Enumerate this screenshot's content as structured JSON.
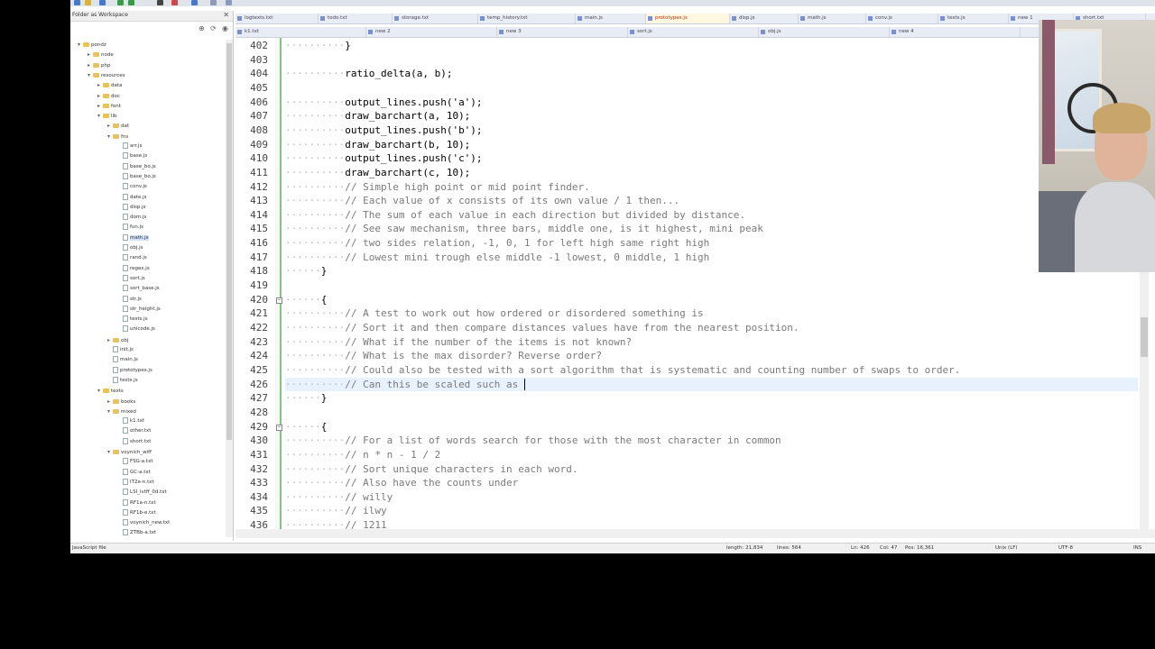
{
  "window": {
    "sidebar_title": "Folder as Workspace"
  },
  "sidebar": {
    "tree": [
      {
        "label": "pondz",
        "depth": 0,
        "type": "folder",
        "open": true
      },
      {
        "label": "node",
        "depth": 1,
        "type": "folder",
        "open": false
      },
      {
        "label": "php",
        "depth": 1,
        "type": "folder",
        "open": false
      },
      {
        "label": "resources",
        "depth": 1,
        "type": "folder",
        "open": true
      },
      {
        "label": "data",
        "depth": 2,
        "type": "folder",
        "open": false
      },
      {
        "label": "doc",
        "depth": 2,
        "type": "folder",
        "open": false
      },
      {
        "label": "font",
        "depth": 2,
        "type": "folder",
        "open": false
      },
      {
        "label": "lib",
        "depth": 2,
        "type": "folder",
        "open": true
      },
      {
        "label": "dat",
        "depth": 3,
        "type": "folder",
        "open": false
      },
      {
        "label": "fns",
        "depth": 3,
        "type": "folder",
        "open": true
      },
      {
        "label": "arr.js",
        "depth": 4,
        "type": "file"
      },
      {
        "label": "base.js",
        "depth": 4,
        "type": "file"
      },
      {
        "label": "base_bo.js",
        "depth": 4,
        "type": "file"
      },
      {
        "label": "base_bo.js",
        "depth": 4,
        "type": "file"
      },
      {
        "label": "conv.js",
        "depth": 4,
        "type": "file"
      },
      {
        "label": "date.js",
        "depth": 4,
        "type": "file"
      },
      {
        "label": "disp.js",
        "depth": 4,
        "type": "file"
      },
      {
        "label": "dom.js",
        "depth": 4,
        "type": "file"
      },
      {
        "label": "fun.js",
        "depth": 4,
        "type": "file"
      },
      {
        "label": "math.js",
        "depth": 4,
        "type": "file",
        "selected": true
      },
      {
        "label": "obj.js",
        "depth": 4,
        "type": "file"
      },
      {
        "label": "rand.js",
        "depth": 4,
        "type": "file"
      },
      {
        "label": "regex.js",
        "depth": 4,
        "type": "file"
      },
      {
        "label": "sort.js",
        "depth": 4,
        "type": "file"
      },
      {
        "label": "sort_base.js",
        "depth": 4,
        "type": "file"
      },
      {
        "label": "str.js",
        "depth": 4,
        "type": "file"
      },
      {
        "label": "str_height.js",
        "depth": 4,
        "type": "file"
      },
      {
        "label": "tests.js",
        "depth": 4,
        "type": "file"
      },
      {
        "label": "unicode.js",
        "depth": 4,
        "type": "file"
      },
      {
        "label": "obj",
        "depth": 3,
        "type": "folder",
        "open": false
      },
      {
        "label": "init.js",
        "depth": 3,
        "type": "file"
      },
      {
        "label": "main.js",
        "depth": 3,
        "type": "file"
      },
      {
        "label": "prototypes.js",
        "depth": 3,
        "type": "file"
      },
      {
        "label": "tests.js",
        "depth": 3,
        "type": "file"
      },
      {
        "label": "texts",
        "depth": 2,
        "type": "folder",
        "open": true
      },
      {
        "label": "books",
        "depth": 3,
        "type": "folder",
        "open": false
      },
      {
        "label": "mixed",
        "depth": 3,
        "type": "folder",
        "open": true
      },
      {
        "label": "k1.txt",
        "depth": 4,
        "type": "file"
      },
      {
        "label": "other.txt",
        "depth": 4,
        "type": "file"
      },
      {
        "label": "short.txt",
        "depth": 4,
        "type": "file"
      },
      {
        "label": "voynich_wiff",
        "depth": 3,
        "type": "folder",
        "open": true
      },
      {
        "label": "FSG-a.txt",
        "depth": 4,
        "type": "file"
      },
      {
        "label": "GC-a.txt",
        "depth": 4,
        "type": "file"
      },
      {
        "label": "IT2e-n.txt",
        "depth": 4,
        "type": "file"
      },
      {
        "label": "LSI_ivtff_0d.txt",
        "depth": 4,
        "type": "file"
      },
      {
        "label": "RF1a-n.txt",
        "depth": 4,
        "type": "file"
      },
      {
        "label": "RF1b-e.txt",
        "depth": 4,
        "type": "file"
      },
      {
        "label": "voynich_new.txt",
        "depth": 4,
        "type": "file"
      },
      {
        "label": "ZTBb-a.txt",
        "depth": 4,
        "type": "file"
      }
    ]
  },
  "tabs_row1": [
    "logtexts.txt",
    "todo.txt",
    "storage.txt",
    "temp_history.txt",
    "main.js",
    "prototypes.js",
    "disp.js",
    "math.js",
    "conv.js",
    "tests.js",
    "new 1",
    "short.txt"
  ],
  "tabs_row1_active": 5,
  "tabs_row2": [
    "k1.txt",
    "new 2",
    "new 3",
    "sort.js",
    "obj.js",
    "new 4"
  ],
  "editor": {
    "lines": [
      {
        "n": "402",
        "indent": 10,
        "text": "}",
        "type": "code"
      },
      {
        "n": "403",
        "indent": 0,
        "text": "",
        "type": "code"
      },
      {
        "n": "404",
        "indent": 10,
        "text": "ratio_delta(a, b);",
        "type": "code"
      },
      {
        "n": "405",
        "indent": 0,
        "text": "",
        "type": "code"
      },
      {
        "n": "406",
        "indent": 10,
        "text": "output_lines.push('a');",
        "type": "code"
      },
      {
        "n": "407",
        "indent": 10,
        "text": "draw_barchart(a, 10);",
        "type": "code"
      },
      {
        "n": "408",
        "indent": 10,
        "text": "output_lines.push('b');",
        "type": "code"
      },
      {
        "n": "409",
        "indent": 10,
        "text": "draw_barchart(b, 10);",
        "type": "code"
      },
      {
        "n": "410",
        "indent": 10,
        "text": "output_lines.push('c');",
        "type": "code"
      },
      {
        "n": "411",
        "indent": 10,
        "text": "draw_barchart(c, 10);",
        "type": "code"
      },
      {
        "n": "412",
        "indent": 10,
        "text": "// Simple high point or mid point finder.",
        "type": "comment"
      },
      {
        "n": "413",
        "indent": 10,
        "text": "// Each value of x consists of its own value / 1 then...",
        "type": "comment"
      },
      {
        "n": "414",
        "indent": 10,
        "text": "// The sum of each value in each direction but divided by distance.",
        "type": "comment"
      },
      {
        "n": "415",
        "indent": 10,
        "text": "// See saw mechanism, three bars, middle one, is it highest, mini peak",
        "type": "comment"
      },
      {
        "n": "416",
        "indent": 10,
        "text": "// two sides relation, -1, 0, 1 for left high same right high",
        "type": "comment"
      },
      {
        "n": "417",
        "indent": 10,
        "text": "// Lowest mini trough else middle -1 lowest, 0 middle, 1 high",
        "type": "comment"
      },
      {
        "n": "418",
        "indent": 6,
        "text": "}",
        "type": "code"
      },
      {
        "n": "419",
        "indent": 0,
        "text": "",
        "type": "code"
      },
      {
        "n": "420",
        "indent": 6,
        "text": "{",
        "type": "code"
      },
      {
        "n": "421",
        "indent": 10,
        "text": "// A test to work out how ordered or disordered something is",
        "type": "comment"
      },
      {
        "n": "422",
        "indent": 10,
        "text": "// Sort it and then compare distances values have from the nearest position.",
        "type": "comment"
      },
      {
        "n": "423",
        "indent": 10,
        "text": "// What if the number of the items is not known?",
        "type": "comment"
      },
      {
        "n": "424",
        "indent": 10,
        "text": "// What is the max disorder? Reverse order?",
        "type": "comment"
      },
      {
        "n": "425",
        "indent": 10,
        "text": "// Could also be tested with a sort algorithm that is systematic and counting number of swaps to order.",
        "type": "comment"
      },
      {
        "n": "426",
        "indent": 10,
        "text": "// Can this be scaled such as ",
        "type": "comment",
        "current": true
      },
      {
        "n": "427",
        "indent": 6,
        "text": "}",
        "type": "code"
      },
      {
        "n": "428",
        "indent": 0,
        "text": "",
        "type": "code"
      },
      {
        "n": "429",
        "indent": 6,
        "text": "{",
        "type": "code"
      },
      {
        "n": "430",
        "indent": 10,
        "text": "// For a list of words search for those with the most character in common",
        "type": "comment"
      },
      {
        "n": "431",
        "indent": 10,
        "text": "// n * n - 1 / 2",
        "type": "comment"
      },
      {
        "n": "432",
        "indent": 10,
        "text": "// Sort unique characters in each word.",
        "type": "comment"
      },
      {
        "n": "433",
        "indent": 10,
        "text": "// Also have the counts under",
        "type": "comment"
      },
      {
        "n": "434",
        "indent": 10,
        "text": "// willy",
        "type": "comment"
      },
      {
        "n": "435",
        "indent": 10,
        "text": "// ilwy",
        "type": "comment"
      },
      {
        "n": "436",
        "indent": 10,
        "text": "// 1211",
        "type": "comment"
      }
    ]
  },
  "status": {
    "file_type": "JavaScript file",
    "length": "length: 21,834",
    "lines": "lines: 564",
    "ln": "Ln: 426",
    "col": "Col: 47",
    "pos": "Pos: 16,361",
    "eol": "Unix (LF)",
    "encoding": "UTF-8",
    "mode": "INS"
  }
}
